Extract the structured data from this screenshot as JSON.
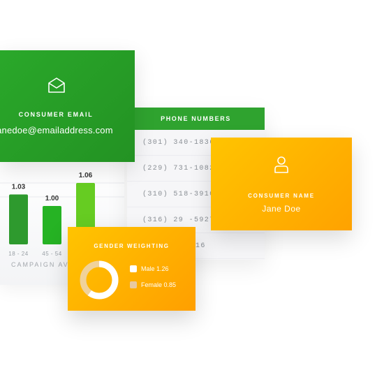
{
  "chart_data": {
    "type": "bar",
    "categories": [
      "18 - 24",
      "45 - 54",
      ""
    ],
    "values": [
      1.03,
      1.0,
      1.06
    ],
    "value_labels": [
      "1.03",
      "1.00",
      "1.06"
    ],
    "caption": "CAMPAIGN AV",
    "colors": [
      "#2e9a2e",
      "#26b324",
      "#66cc22"
    ]
  },
  "email_card": {
    "icon": "envelope-open-icon",
    "title": "CONSUMER EMAIL",
    "value": "janedoe@emailaddress.com"
  },
  "phone_card": {
    "title": "PHONE NUMBERS",
    "numbers": [
      "(301) 340-1836",
      "(229) 731-1082",
      "(310) 518-3910",
      "(316) 29 -5927",
      "16"
    ]
  },
  "name_card": {
    "icon": "user-icon",
    "title": "CONSUMER NAME",
    "value": "Jane Doe"
  },
  "gender_card": {
    "title": "GENDER WEIGHTING",
    "legend": [
      {
        "label": "Male 1.26",
        "color": "#ffffff"
      },
      {
        "label": "Female 0.85",
        "color": "#e8c9a0"
      }
    ],
    "donut": {
      "male_fraction": 0.6,
      "colors": [
        "#ffffff",
        "#f0d29a"
      ]
    }
  }
}
